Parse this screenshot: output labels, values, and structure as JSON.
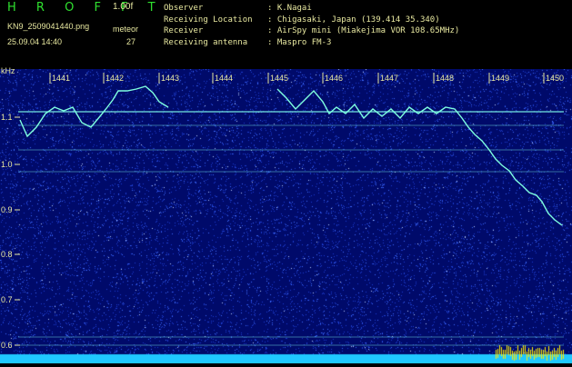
{
  "header": {
    "brand": "H R O F F T",
    "version": "1.00f",
    "filename": "KN9_2509041440.png",
    "mode": "meteor",
    "datetime": "25.09.04 14:40",
    "count": "27",
    "fields": [
      {
        "label": "Observer",
        "value": ": K.Nagai"
      },
      {
        "label": "Receiving Location",
        "value": ": Chigasaki, Japan (139.414 35.340)"
      },
      {
        "label": "Receiver",
        "value": ": AirSpy mini (Miakejima VOR 108.65MHz)"
      },
      {
        "label": "Receiving antenna",
        "value": ": Maspro FM-3"
      }
    ]
  },
  "plot": {
    "y_unit": "kHz",
    "y_ticks": [
      "1.1",
      "1.0",
      "0.9",
      "0.8",
      "0.7",
      "0.6"
    ],
    "minute_ticks": [
      "1441",
      "1442",
      "1443",
      "1444",
      "1445",
      "1446",
      "1447",
      "1448",
      "1449",
      "1450"
    ],
    "colors": {
      "background": "#000a6a",
      "noise": "#3f6cff",
      "trace": "#7fffe0",
      "carrier": "#7ffff0",
      "axis": "#e8e8a0"
    }
  }
}
